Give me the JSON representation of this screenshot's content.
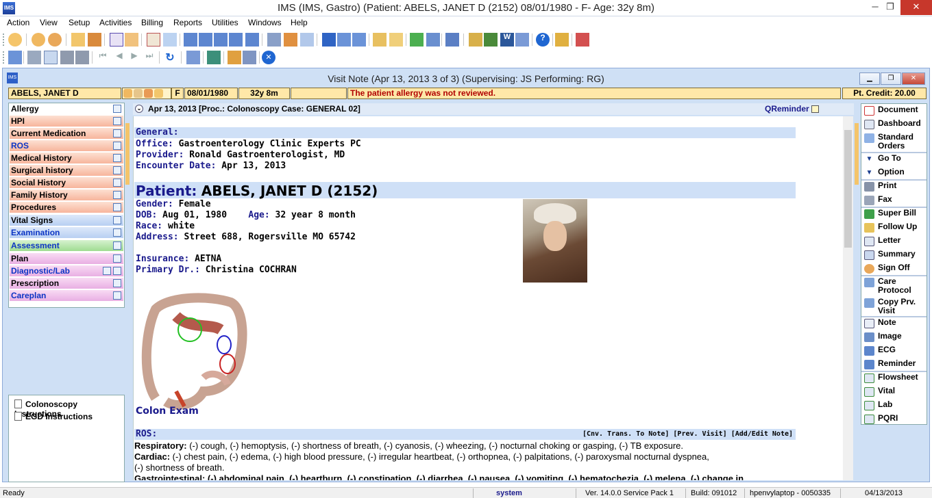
{
  "app": {
    "title": "IMS (IMS, Gastro)     (Patient: ABELS, JANET  D (2152) 08/01/1980 - F- Age: 32y 8m)",
    "minimize": "─",
    "restore": "❐",
    "close": "✕"
  },
  "menu": [
    "Action",
    "View",
    "Setup",
    "Activities",
    "Billing",
    "Reports",
    "Utilities",
    "Windows",
    "Help"
  ],
  "visit_window": {
    "title": "Visit Note (Apr 13, 2013   3 of 3) (Supervising: JS Performing: RG)"
  },
  "patient_bar": {
    "name": "ABELS, JANET  D",
    "sex": "F",
    "dob": "08/01/1980",
    "age": "32y 8m",
    "alert": "The patient allergy was not reviewed.",
    "credit": "Pt. Credit: 20.00"
  },
  "nav": [
    {
      "label": "Allergy"
    },
    {
      "label": "HPI"
    },
    {
      "label": "Current Medication"
    },
    {
      "label": "ROS"
    },
    {
      "label": "Medical History"
    },
    {
      "label": "Surgical history"
    },
    {
      "label": "Social History"
    },
    {
      "label": "Family History"
    },
    {
      "label": "Procedures"
    },
    {
      "label": "Vital Signs"
    },
    {
      "label": "Examination"
    },
    {
      "label": "Assessment"
    },
    {
      "label": "Plan"
    },
    {
      "label": "Diagnostic/Lab"
    },
    {
      "label": "Prescription"
    },
    {
      "label": "Careplan"
    }
  ],
  "instructions": [
    "Colonoscopy Instructions",
    "EGD Instructions"
  ],
  "doc_header": {
    "text": "Apr 13, 2013  [Proc.: Colonoscopy  Case: GENERAL 02]",
    "qreminder": "QReminder"
  },
  "general": {
    "heading": "General:",
    "office_label": "Office:",
    "office": "Gastroenterology Clinic Experts PC",
    "provider_label": "Provider:",
    "provider": "Ronald Gastroenterologist, MD",
    "encounter_label": "Encounter Date:",
    "encounter": "Apr 13, 2013"
  },
  "patient": {
    "heading_label": "Patient:",
    "heading_value": "ABELS, JANET  D   (2152)",
    "gender_label": "Gender:",
    "gender": "Female",
    "dob_label": "DOB:",
    "dob": "Aug 01, 1980",
    "age_label": "Age:",
    "age": "32 year 8 month",
    "race_label": "Race:",
    "race": "white",
    "address_label": "Address:",
    "address": "Street 688, Rogersville MO  65742",
    "insurance_label": "Insurance:",
    "insurance": "AETNA",
    "primary_label": "Primary Dr.:",
    "primary": "Christina  COCHRAN"
  },
  "exam_image_caption": "Colon Exam",
  "ros": {
    "heading": "ROS:",
    "links": "[Cnv. Trans. To Note]  [Prev. Visit]  [Add/Edit Note]",
    "respiratory_label": "Respiratory:",
    "respiratory": "(-) cough, (-) hemoptysis, (-) shortness of breath, (-) cyanosis, (-) wheezing, (-) nocturnal choking or gasping, (-) TB exposure.",
    "cardiac_label": "Cardiac:",
    "cardiac": "(-) chest pain, (-) edema, (-) high blood pressure, (-) irregular heartbeat, (-) orthopnea, (-) palpitations, (-) paroxysmal nocturnal dyspnea,",
    "cardiac_cont": "(-) shortness of breath.",
    "gi_partial": "Gastrointestinal: (-) abdominal pain, (-) heartburn, (-) constipation, (-) diarrhea, (-) nausea, (-) vomiting, (-) hematochezia, (-) melena, (-) change in"
  },
  "right_panel": [
    {
      "label": "Document",
      "icon": "document-icon"
    },
    {
      "label": "Dashboard",
      "icon": "dashboard-icon"
    },
    {
      "label": "Standard Orders",
      "icon": "standard-orders-icon"
    },
    {
      "label": "Go To",
      "icon": "triangle-down-icon"
    },
    {
      "label": "Option",
      "icon": "triangle-down-icon"
    },
    {
      "label": "Print",
      "icon": "printer-icon"
    },
    {
      "label": "Fax",
      "icon": "fax-icon"
    },
    {
      "label": "Super Bill",
      "icon": "super-bill-icon"
    },
    {
      "label": "Follow Up",
      "icon": "follow-up-icon"
    },
    {
      "label": "Letter",
      "icon": "letter-icon"
    },
    {
      "label": "Summary",
      "icon": "summary-icon"
    },
    {
      "label": "Sign Off",
      "icon": "sign-off-icon"
    },
    {
      "label": "Care Protocol",
      "icon": "care-protocol-icon"
    },
    {
      "label": "Copy Prv. Visit",
      "icon": "copy-visit-icon"
    },
    {
      "label": "Note",
      "icon": "note-icon"
    },
    {
      "label": "Image",
      "icon": "image-icon"
    },
    {
      "label": "ECG",
      "icon": "ecg-icon"
    },
    {
      "label": "Reminder",
      "icon": "reminder-icon"
    },
    {
      "label": "Flowsheet",
      "icon": "flowsheet-icon"
    },
    {
      "label": "Vital",
      "icon": "vital-icon"
    },
    {
      "label": "Lab",
      "icon": "lab-icon"
    },
    {
      "label": "PQRI",
      "icon": "pqri-icon"
    }
  ],
  "status": {
    "ready": "Ready",
    "user": "system",
    "version": "Ver. 14.0.0 Service Pack 1",
    "build": "Build: 091012",
    "machine": "hpenvylaptop - 0050335",
    "date": "04/13/2013"
  },
  "colors": {
    "nav_salmon": "#f7b59c",
    "nav_blue": "#b8cff2",
    "nav_green": "#9fdc91",
    "nav_pink": "#e9afe3",
    "patient_bar": "#ffe8a8",
    "alert_red": "#b00000",
    "section_band": "#cfe0f7"
  }
}
